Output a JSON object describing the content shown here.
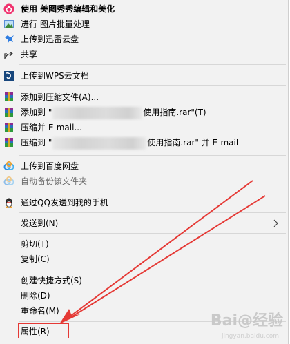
{
  "menu": {
    "meitu": "使用 美图秀秀编辑和美化",
    "batch": "进行 图片批量处理",
    "xunlei": "上传到迅雷云盘",
    "share": "共享",
    "wps": "上传到WPS云文档",
    "add_archive": "添加到压缩文件(A)...",
    "add_to_prefix": "添加到 \"",
    "add_to_suffix": "使用指南.rar\"(T)",
    "compress_email": "压缩并 E-mail...",
    "compress_to_prefix": "压缩到 \"",
    "compress_to_suffix": "使用指南.rar\" 并 E-mail",
    "baidu": "上传到百度网盘",
    "auto_backup": "自动备份该文件夹",
    "qq": "通过QQ发送到我的手机",
    "send_to": "发送到(N)",
    "cut": "剪切(T)",
    "copy": "复制(C)",
    "shortcut": "创建快捷方式(S)",
    "delete": "删除(D)",
    "rename": "重命名(M)",
    "properties": "属性(R)"
  },
  "watermark": {
    "main": "Bai@经验",
    "sub": "jingyan.baidu.com"
  },
  "colors": {
    "menu_bg": "#f2f2f2",
    "highlight_box": "#e53935",
    "arrow": "#e53935"
  }
}
